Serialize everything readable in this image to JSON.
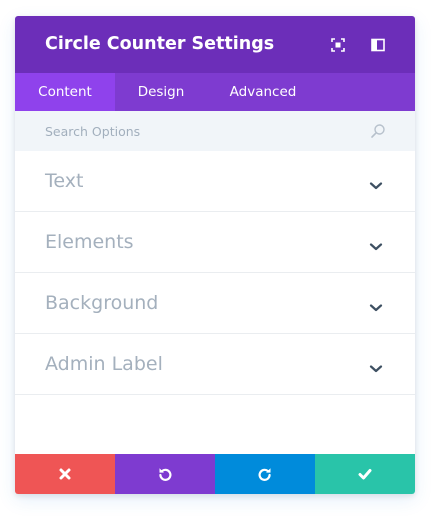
{
  "header": {
    "title": "Circle Counter Settings",
    "bg_color": "#6c2eb9",
    "icons": [
      "fullscreen-icon",
      "sidebar-dock-icon"
    ]
  },
  "tabs": [
    {
      "label": "Content",
      "active": true
    },
    {
      "label": "Design",
      "active": false
    },
    {
      "label": "Advanced",
      "active": false
    }
  ],
  "search": {
    "placeholder": "Search Options",
    "value": ""
  },
  "toggles": [
    {
      "label": "Text"
    },
    {
      "label": "Elements"
    },
    {
      "label": "Background"
    },
    {
      "label": "Admin Label"
    }
  ],
  "footer": {
    "buttons": [
      {
        "action": "discard",
        "icon": "close-icon",
        "color": "#ef5555"
      },
      {
        "action": "undo",
        "icon": "undo-icon",
        "color": "#7e3bd0"
      },
      {
        "action": "redo",
        "icon": "redo-icon",
        "color": "#008bdb"
      },
      {
        "action": "save",
        "icon": "checkmark-icon",
        "color": "#29c4a9"
      }
    ]
  }
}
